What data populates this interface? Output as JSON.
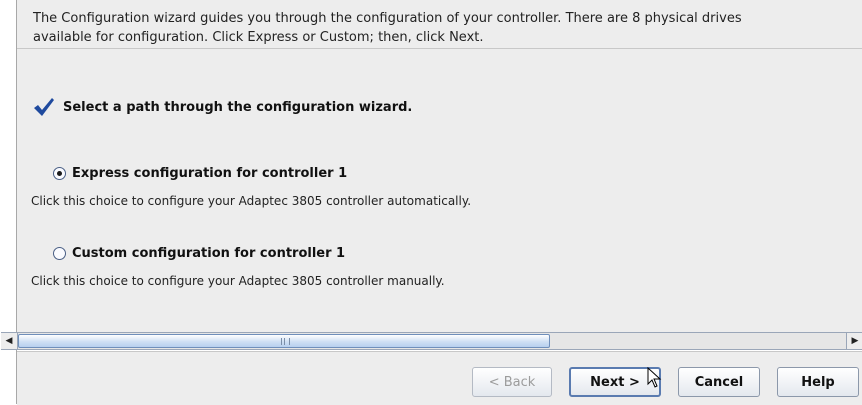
{
  "intro": {
    "line1": "The Configuration wizard guides you through the configuration of your controller. There are 8 physical drives",
    "line2": "available for configuration. Click Express or Custom; then, click Next."
  },
  "heading": {
    "icon": "checkmark-icon",
    "text": "Select a path through the configuration wizard."
  },
  "options": [
    {
      "label": "Express configuration for controller 1",
      "description": "Click this choice to configure your Adaptec 3805 controller automatically.",
      "selected": true
    },
    {
      "label": "Custom configuration for controller 1",
      "description": "Click this choice to configure your Adaptec 3805 controller manually.",
      "selected": false
    }
  ],
  "scrollbar": {
    "left_arrow": "◀",
    "right_arrow": "▶"
  },
  "buttons": {
    "back": "< Back",
    "next": "Next >",
    "cancel": "Cancel",
    "help": "Help"
  },
  "colors": {
    "accent": "#1f4a9e",
    "panel_bg": "#ededed"
  }
}
